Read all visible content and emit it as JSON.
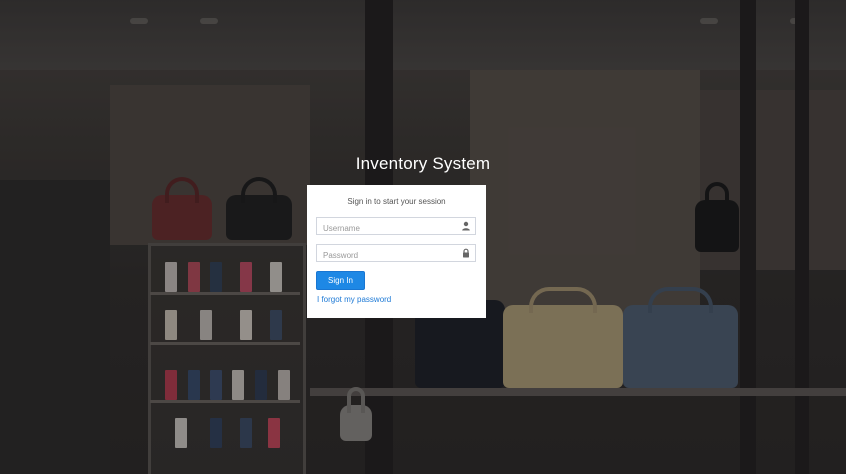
{
  "app": {
    "title_main": "Inventory",
    "title_sub": "System"
  },
  "login": {
    "message": "Sign in to start your session",
    "username_placeholder": "Username",
    "password_placeholder": "Password",
    "sign_in_label": "Sign In",
    "forgot_label": "I forgot my password"
  },
  "icons": {
    "username": "user-icon",
    "password": "lock-icon"
  },
  "colors": {
    "primary_button": "#1e88e5",
    "link": "#1e7ad6",
    "overlay": "#141416"
  }
}
